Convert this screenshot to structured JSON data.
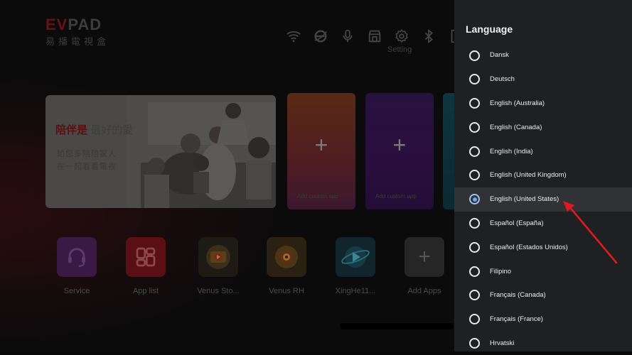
{
  "brand": {
    "mark_left": "EV",
    "mark_right": "PAD",
    "subtitle": "易播電視盒"
  },
  "status": {
    "setting_label": "Setting"
  },
  "banner": {
    "title_bold": "陪伴是",
    "title_light": "最好的愛",
    "line1": "給您多陪陪家人",
    "line2": "在一起看看電視"
  },
  "cards": [
    {
      "caption": "Add custom app"
    },
    {
      "caption": "Add custom app"
    }
  ],
  "apps": [
    {
      "name": "Service"
    },
    {
      "name": "App list"
    },
    {
      "name": "Venus Sto..."
    },
    {
      "name": "Venus RH"
    },
    {
      "name": "XingHe11..."
    },
    {
      "name": "Add Apps"
    }
  ],
  "language_panel": {
    "title": "Language",
    "selected": "English (United States)",
    "options": [
      "Dansk",
      "Deutsch",
      "English (Australia)",
      "English (Canada)",
      "English (India)",
      "English (United Kingdom)",
      "English (United States)",
      "Español (España)",
      "Español (Estados Unidos)",
      "Filipino",
      "Français (Canada)",
      "Français (France)",
      "Hrvatski"
    ]
  },
  "colors": {
    "accent": "#6fa7ea",
    "panel_bg": "#1f2022",
    "annotation_arrow": "#e0191e"
  }
}
